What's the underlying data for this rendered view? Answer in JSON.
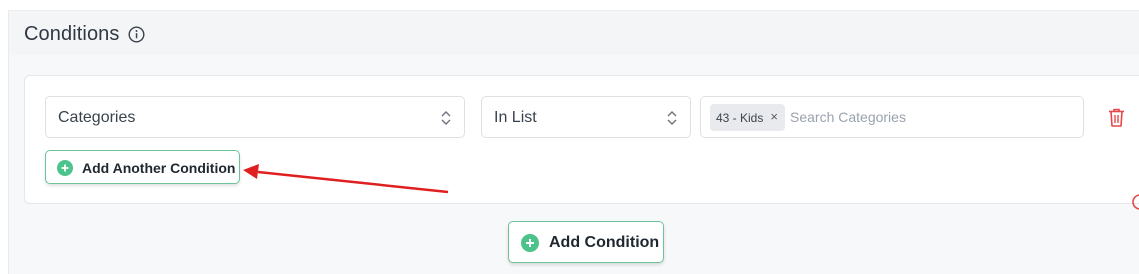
{
  "header": {
    "title": "Conditions",
    "info_icon": "info-circle-icon"
  },
  "condition_row": {
    "field_select": {
      "value": "Categories"
    },
    "operator_select": {
      "value": "In List"
    },
    "values": {
      "tags": [
        {
          "label": "43 - Kids",
          "remove": "×"
        }
      ],
      "placeholder": "Search Categories"
    },
    "delete_icon": "trash-icon"
  },
  "buttons": {
    "add_another_condition": "Add Another Condition",
    "add_condition": "Add Condition"
  },
  "colors": {
    "accent_green": "#4cc38a",
    "delete_red": "#e54848",
    "annotation_arrow": "#e02020"
  }
}
